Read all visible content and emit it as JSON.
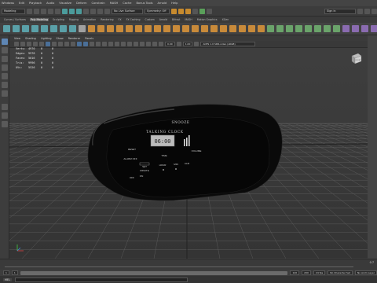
{
  "menubar": {
    "items": [
      "Windows",
      "Edit",
      "Playback",
      "Audio",
      "Visualize",
      "Deform",
      "Constrain",
      "MASH",
      "Cache",
      "Bonus Tools",
      "Arnold",
      "Help"
    ]
  },
  "statusline": {
    "workspace": "Modeling",
    "mode_field": "No Live Surface",
    "symmetry": "Symmetry: Off",
    "sign_in": "Sign in"
  },
  "shelf_tabs": [
    "Curves / Surfaces",
    "Poly Modeling",
    "Sculpting",
    "Rigging",
    "Animation",
    "Rendering",
    "FX",
    "FX Caching",
    "Custom",
    "Arnold",
    "Bifrost",
    "MASH",
    "Motion Graphics",
    "XGen"
  ],
  "shelf_active_tab": 1,
  "viewport": {
    "menu": [
      "View",
      "Shading",
      "Lighting",
      "Show",
      "Renderer",
      "Panels"
    ],
    "exposure_value": "0.00",
    "gamma_value": "1.00",
    "colorspace": "ACES 1.0 SDR-video (sRGB)",
    "hud": [
      [
        "Verts:",
        "4970",
        "0",
        "0"
      ],
      [
        "Edges:",
        "9978",
        "0",
        "0"
      ],
      [
        "Faces:",
        "5016",
        "0",
        "0"
      ],
      [
        "Tris:",
        "9996",
        "0",
        "0"
      ],
      [
        "UVs:",
        "5526",
        "0",
        "0"
      ]
    ],
    "viewcube_label": "FRONT"
  },
  "clock": {
    "top_label": "SNOOZE",
    "name_label": "TALKING CLOCK",
    "display": "06:00",
    "reset": "RESET",
    "alarm_off": "ALARM OFF",
    "time": "TIME",
    "set": "SET",
    "hour": "HOUR",
    "min": "MIN",
    "alm": "ALM",
    "minute": "MINUTE",
    "volume": "VOLUME",
    "off": "OFF",
    "on": "ON",
    "mode": "MODE"
  },
  "timeline": {
    "start": "1",
    "end": "120",
    "current": "1",
    "range_start": "1",
    "range_end": "120",
    "anim_start": "1",
    "anim_end": "200",
    "fps": "24 fps",
    "character_set": "No Character Set",
    "anim_layer": "No Anim Layer",
    "frame_readout": "0.7"
  },
  "cmdline": {
    "label": "MEL"
  }
}
